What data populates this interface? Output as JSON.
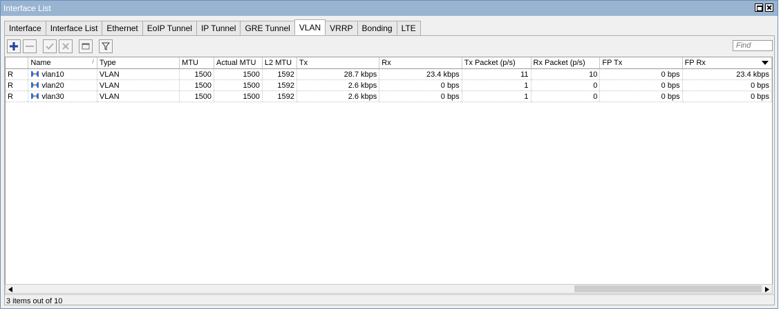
{
  "window": {
    "title": "Interface List"
  },
  "tabs": [
    {
      "label": "Interface"
    },
    {
      "label": "Interface List"
    },
    {
      "label": "Ethernet"
    },
    {
      "label": "EoIP Tunnel"
    },
    {
      "label": "IP Tunnel"
    },
    {
      "label": "GRE Tunnel"
    },
    {
      "label": "VLAN",
      "active": true
    },
    {
      "label": "VRRP"
    },
    {
      "label": "Bonding"
    },
    {
      "label": "LTE"
    }
  ],
  "toolbar": {
    "buttons": [
      "add-icon",
      "remove-icon",
      "enable-check-icon",
      "disable-x-icon",
      "comment-icon",
      "filter-icon"
    ],
    "find_placeholder": "Find"
  },
  "table": {
    "columns": [
      "",
      "Name",
      "Type",
      "MTU",
      "Actual MTU",
      "L2 MTU",
      "Tx",
      "Rx",
      "Tx Packet (p/s)",
      "Rx Packet (p/s)",
      "FP Tx",
      "FP Rx"
    ],
    "rows": [
      {
        "flag": "R",
        "name": "vlan10",
        "type": "VLAN",
        "mtu": "1500",
        "actual_mtu": "1500",
        "l2mtu": "1592",
        "tx": "28.7 kbps",
        "rx": "23.4 kbps",
        "tx_pps": "11",
        "rx_pps": "10",
        "fp_tx": "0 bps",
        "fp_rx": "23.4 kbps"
      },
      {
        "flag": "R",
        "name": "vlan20",
        "type": "VLAN",
        "mtu": "1500",
        "actual_mtu": "1500",
        "l2mtu": "1592",
        "tx": "2.6 kbps",
        "rx": "0 bps",
        "tx_pps": "1",
        "rx_pps": "0",
        "fp_tx": "0 bps",
        "fp_rx": "0 bps"
      },
      {
        "flag": "R",
        "name": "vlan30",
        "type": "VLAN",
        "mtu": "1500",
        "actual_mtu": "1500",
        "l2mtu": "1592",
        "tx": "2.6 kbps",
        "rx": "0 bps",
        "tx_pps": "1",
        "rx_pps": "0",
        "fp_tx": "0 bps",
        "fp_rx": "0 bps"
      }
    ]
  },
  "status": {
    "text": "3 items out of 10"
  },
  "colors": {
    "titlebar": "#99b4d1",
    "accent": "#1f4fb5"
  }
}
